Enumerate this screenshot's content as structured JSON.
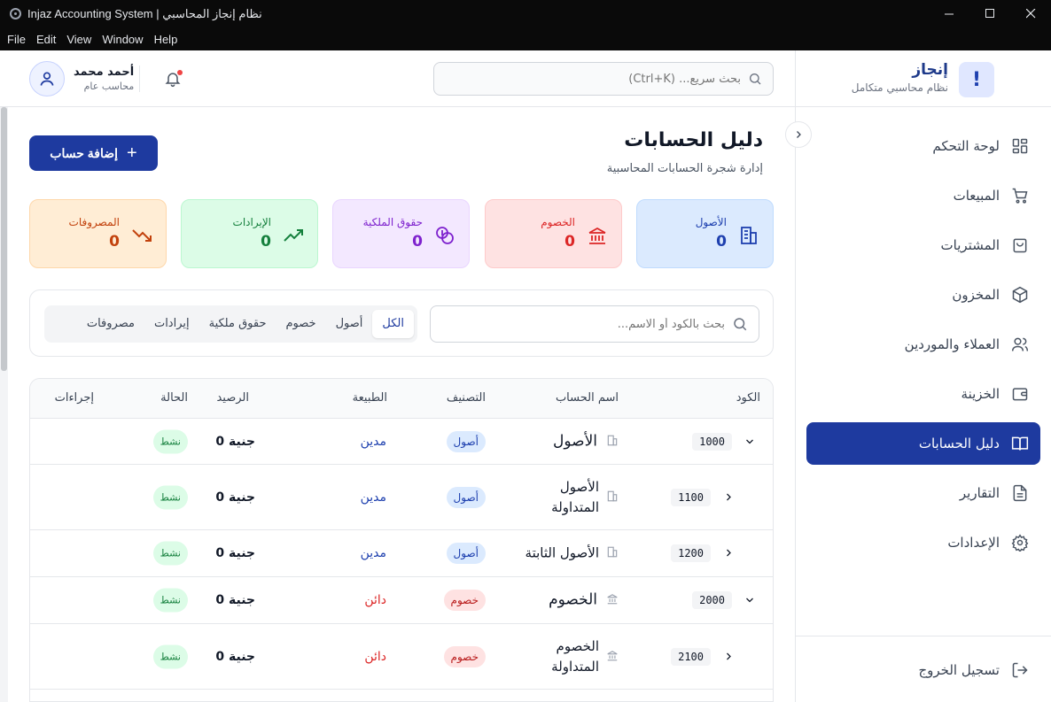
{
  "window": {
    "title": "Injaz Accounting System | نظام إنجاز المحاسبي"
  },
  "menu": [
    "File",
    "Edit",
    "View",
    "Window",
    "Help"
  ],
  "sidebar": {
    "brand_name": "إنجاز",
    "brand_sub": "نظام محاسبي متكامل",
    "brand_logo": "!",
    "items": [
      {
        "label": "لوحة التحكم",
        "icon": "dashboard-icon"
      },
      {
        "label": "المبيعات",
        "icon": "cart-icon"
      },
      {
        "label": "المشتريات",
        "icon": "bag-icon"
      },
      {
        "label": "المخزون",
        "icon": "box-icon"
      },
      {
        "label": "العملاء والموردين",
        "icon": "users-icon"
      },
      {
        "label": "الخزينة",
        "icon": "wallet-icon"
      },
      {
        "label": "دليل الحسابات",
        "icon": "book-icon",
        "active": true
      },
      {
        "label": "التقارير",
        "icon": "report-icon"
      },
      {
        "label": "الإعدادات",
        "icon": "gear-icon"
      }
    ],
    "logout_label": "تسجيل الخروج"
  },
  "header": {
    "search_placeholder": "بحث سريع... (Ctrl+K)",
    "user_name": "أحمد محمد",
    "user_role": "محاسب عام"
  },
  "page": {
    "title": "دليل الحسابات",
    "subtitle": "إدارة شجرة الحسابات المحاسبية",
    "add_button": "إضافة حساب"
  },
  "stats": [
    {
      "label": "الأصول",
      "value": "0",
      "color": "#1e40af"
    },
    {
      "label": "الخصوم",
      "value": "0",
      "color": "#dc2626"
    },
    {
      "label": "حقوق الملكية",
      "value": "0",
      "color": "#7e22ce"
    },
    {
      "label": "الإيرادات",
      "value": "0",
      "color": "#15803d"
    },
    {
      "label": "المصروفات",
      "value": "0",
      "color": "#c2410c"
    }
  ],
  "filters": {
    "search_placeholder": "بحث بالكود أو الاسم...",
    "tabs": [
      "الكل",
      "أصول",
      "خصوم",
      "حقوق ملكية",
      "إيرادات",
      "مصروفات"
    ],
    "active_tab": "الكل"
  },
  "table": {
    "headers": {
      "code": "الكود",
      "name": "اسم الحساب",
      "category": "التصنيف",
      "nature": "الطبيعة",
      "balance": "الرصيد",
      "status": "الحالة",
      "actions": "إجراءات"
    },
    "rows": [
      {
        "code": "1000",
        "name": "الأصول",
        "category": "أصول",
        "nature": "مدين",
        "balance": "0 جنية",
        "status": "نشط"
      },
      {
        "code": "1100",
        "name_line1": "الأصول",
        "name_line2": "المتداولة",
        "category": "أصول",
        "nature": "مدين",
        "balance": "0 جنية",
        "status": "نشط"
      },
      {
        "code": "1200",
        "name": "الأصول الثابتة",
        "category": "أصول",
        "nature": "مدين",
        "balance": "0 جنية",
        "status": "نشط"
      },
      {
        "code": "2000",
        "name": "الخصوم",
        "category": "خصوم",
        "nature": "دائن",
        "balance": "0 جنية",
        "status": "نشط"
      },
      {
        "code": "2100",
        "name_line1": "الخصوم",
        "name_line2": "المتداولة",
        "category": "خصوم",
        "nature": "دائن",
        "balance": "0 جنية",
        "status": "نشط"
      }
    ]
  }
}
